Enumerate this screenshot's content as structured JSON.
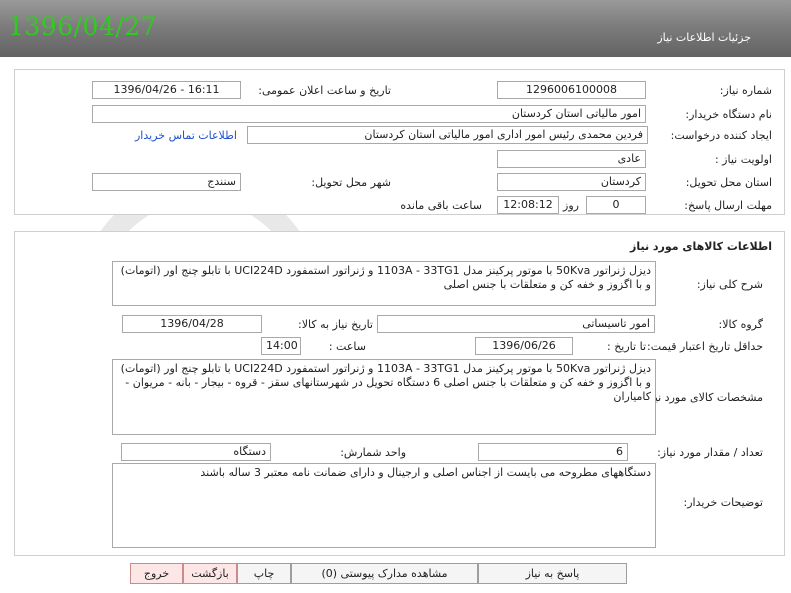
{
  "header": {
    "title": "جزئیات اطلاعات نیاز",
    "date_stamp": "1396/04/27"
  },
  "need_info": {
    "need_number_label": "شماره نیاز:",
    "need_number": "1296006100008",
    "announce_label": "تاریخ و ساعت اعلان عمومی:",
    "announce_value": "1396/04/26 - 16:11",
    "buyer_org_label": "نام دستگاه خریدار:",
    "buyer_org": "امور مالیاتی استان کردستان",
    "requester_label": "ایجاد کننده درخواست:",
    "requester": "فردین محمدی رئیس امور اداری امور مالیاتی استان کردستان",
    "contact_link": "اطلاعات تماس خریدار",
    "priority_label": "اولویت نیاز :",
    "priority": "عادی",
    "province_label": "استان محل تحویل:",
    "province": "کردستان",
    "city_label": "شهر محل تحویل:",
    "city": "سنندج",
    "deadline_label": "مهلت ارسال پاسخ:",
    "deadline_days": "0",
    "days_word": "روز و",
    "deadline_time": "12:08:12",
    "remaining_word": "ساعت باقی مانده"
  },
  "goods": {
    "section_title": "اطلاعات کالاهای مورد نیاز",
    "general_desc_label": "شرح کلی نیاز:",
    "general_desc": "دیزل ژنراتور 50Kva با موتور پرکینز مدل 1103A - 33TG1 و ژنراتور استمفورد UCI224D با تابلو چنج اور (اتومات) و با اگزوز و خفه کن و متعلقات با جنس اصلی",
    "group_label": "گروه کالا:",
    "group": "امور تاسیساتی",
    "need_date_label": "تاریخ نیاز به کالا:",
    "need_date": "1396/04/28",
    "validity_label": "حداقل تاریخ اعتبار قیمت:",
    "to_date_label": "تا تاریخ :",
    "to_date": "1396/06/26",
    "hour_label": "ساعت :",
    "hour": "14:00",
    "specs_label": "مشخصات کالای مورد نیاز:",
    "specs": "دیزل ژنراتور 50Kva با موتور پرکینز مدل 1103A - 33TG1 و ژنراتور استمفورد UCI224D با تابلو چنج اور (اتومات) و با اگزوز و خفه کن و متعلقات با جنس اصلی  6 دستگاه تحویل در شهرستانهای سقز - قروه - بیجار - بانه - مریوان - کامیاران",
    "qty_label": "تعداد / مقدار مورد نیاز:",
    "qty": "6",
    "unit_label": "واحد شمارش:",
    "unit": "دستگاه",
    "notes_label": "توضیحات خریدار:",
    "notes": "دستگاههای مطروحه می بایست از اجناس اصلی و ارجینال و دارای ضمانت نامه معتبر 3 ساله باشند"
  },
  "footer": {
    "reply_btn": "پاسخ به نیاز",
    "attachments_btn": "مشاهده مدارک پیوستی (0)",
    "print_btn": "چاپ",
    "back_btn": "بازگشت",
    "exit_btn": "خروج"
  }
}
